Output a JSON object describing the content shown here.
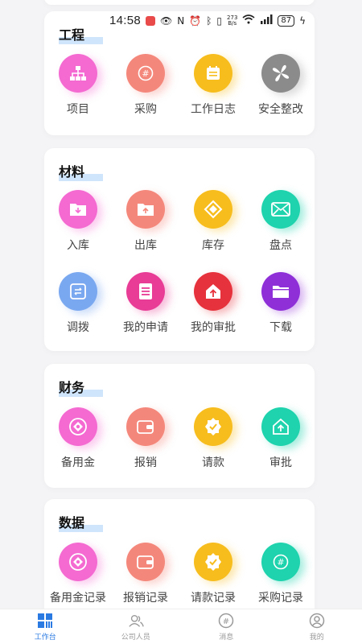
{
  "status_bar": {
    "time": "14:58",
    "net_speed_value": "273",
    "net_speed_unit": "B/s",
    "battery": "87"
  },
  "sections": [
    {
      "title": "工程",
      "items": [
        {
          "label": "项目",
          "icon": "sitemap-icon",
          "color": "#f46ad1"
        },
        {
          "label": "采购",
          "icon": "hash-icon",
          "color": "#f4877b"
        },
        {
          "label": "工作日志",
          "icon": "calendar-log-icon",
          "color": "#f7bd1d"
        },
        {
          "label": "安全整改",
          "icon": "fan-icon",
          "color": "#8b8b8b"
        }
      ]
    },
    {
      "title": "材料",
      "items": [
        {
          "label": "入库",
          "icon": "folder-in-icon",
          "color": "#f46ad1"
        },
        {
          "label": "出库",
          "icon": "folder-out-icon",
          "color": "#f4877b"
        },
        {
          "label": "库存",
          "icon": "diamond-icon",
          "color": "#f7bd1d"
        },
        {
          "label": "盘点",
          "icon": "envelope-icon",
          "color": "#1ed3ad"
        },
        {
          "label": "调拨",
          "icon": "transfer-icon",
          "color": "#7aa8f0"
        },
        {
          "label": "我的申请",
          "icon": "document-icon",
          "color": "#e83c96"
        },
        {
          "label": "我的审批",
          "icon": "upload-icon",
          "color": "#e6323c"
        },
        {
          "label": "下载",
          "icon": "folder-icon",
          "color": "#8e2fd8"
        }
      ]
    },
    {
      "title": "财务",
      "items": [
        {
          "label": "备用金",
          "icon": "coin-icon",
          "color": "#f46ad1"
        },
        {
          "label": "报销",
          "icon": "wallet-icon",
          "color": "#f4877b"
        },
        {
          "label": "请款",
          "icon": "badge-check-icon",
          "color": "#f7bd1d"
        },
        {
          "label": "审批",
          "icon": "house-up-icon",
          "color": "#1ed3ad"
        }
      ]
    },
    {
      "title": "数据",
      "items": [
        {
          "label": "备用金记录",
          "icon": "coin-icon",
          "color": "#f46ad1"
        },
        {
          "label": "报销记录",
          "icon": "wallet-icon",
          "color": "#f4877b"
        },
        {
          "label": "请款记录",
          "icon": "badge-check-icon",
          "color": "#f7bd1d"
        },
        {
          "label": "采购记录",
          "icon": "hash-icon",
          "color": "#1ed3ad"
        }
      ]
    }
  ],
  "bottom_nav": [
    {
      "label": "工作台",
      "icon": "dashboard-icon",
      "active": true
    },
    {
      "label": "公司人员",
      "icon": "people-icon",
      "active": false
    },
    {
      "label": "消息",
      "icon": "message-icon",
      "active": false
    },
    {
      "label": "我的",
      "icon": "profile-icon",
      "active": false
    }
  ],
  "colors": {
    "accent": "#2a7ae2",
    "title_highlight": "#cfe5fb"
  }
}
